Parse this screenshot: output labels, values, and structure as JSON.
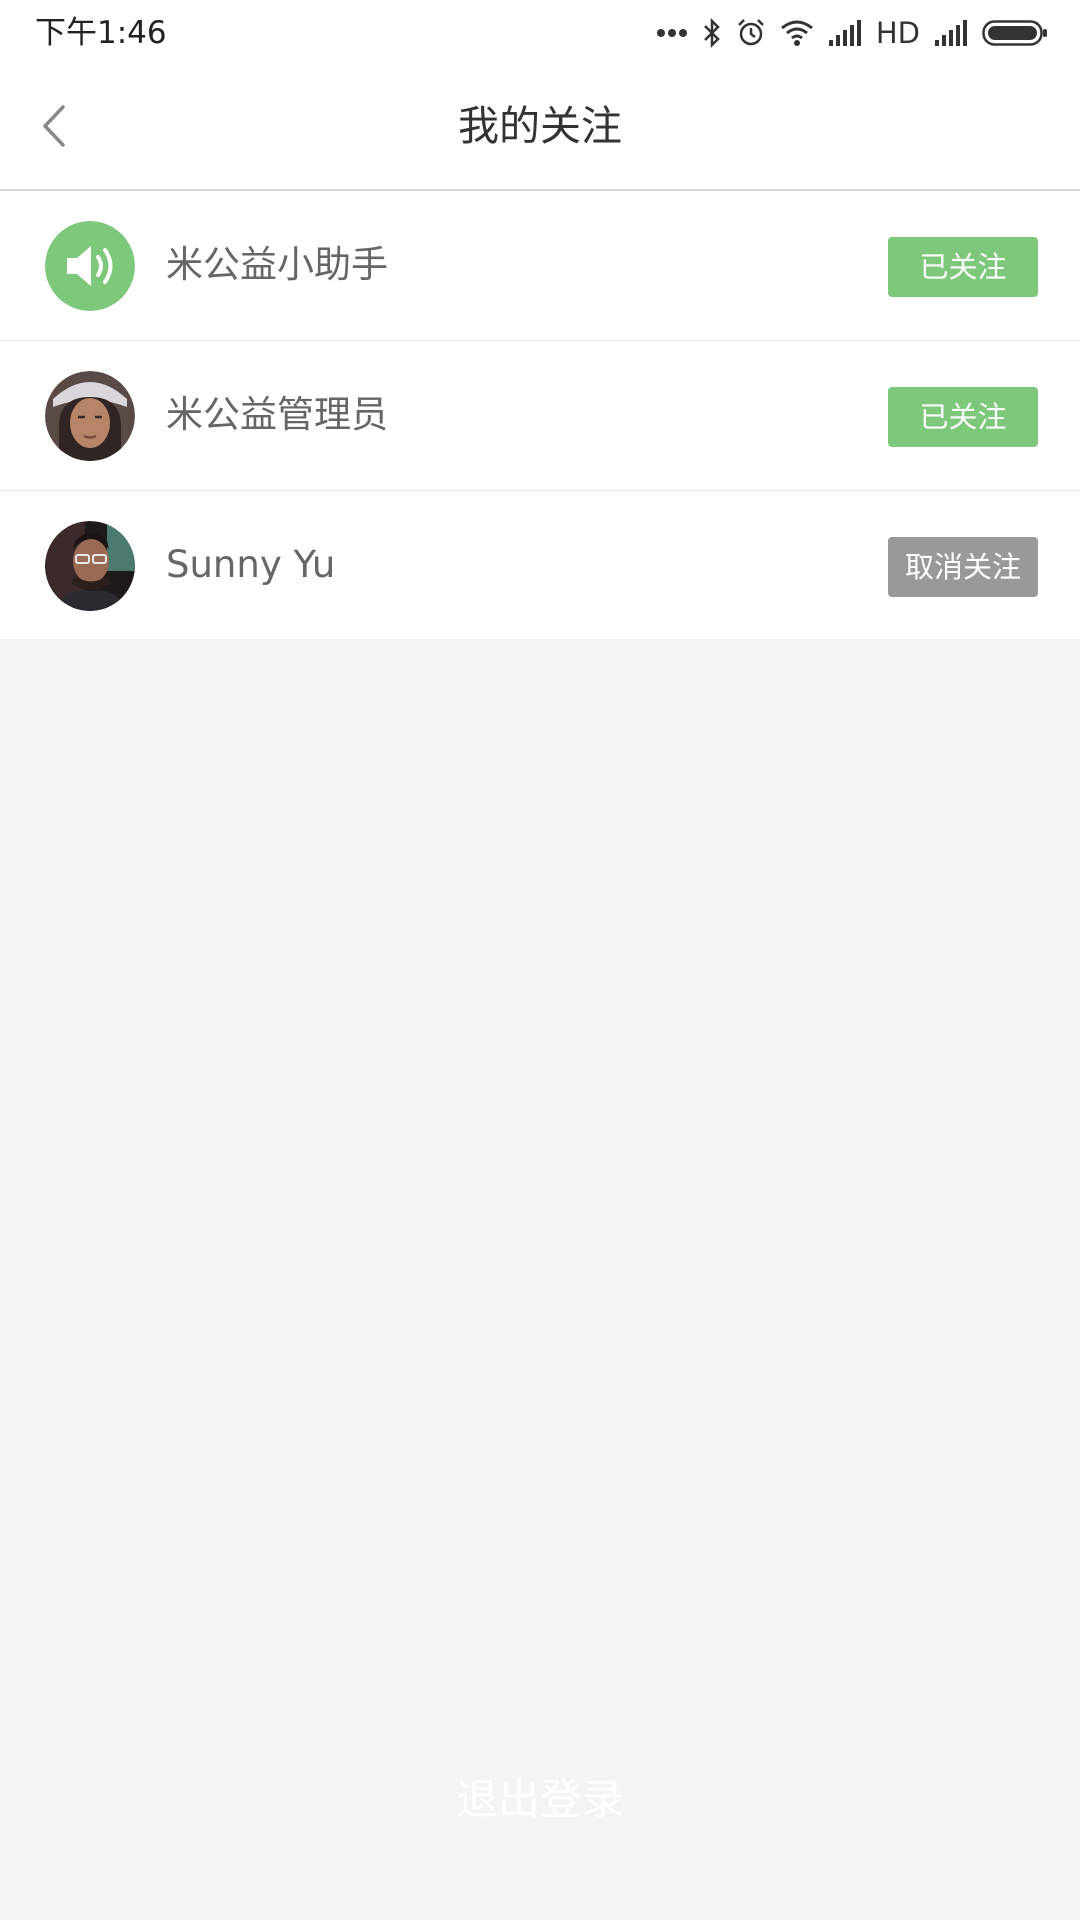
{
  "status_bar": {
    "time": "下午1:46",
    "network_label": "HD",
    "icons": [
      "more-dots-icon",
      "bluetooth-icon",
      "alarm-icon",
      "wifi-icon",
      "signal-icon",
      "signal-icon-2",
      "battery-icon"
    ]
  },
  "header": {
    "title": "我的关注",
    "back_icon": "chevron-left-icon"
  },
  "follows": [
    {
      "name": "米公益小助手",
      "avatar": "speaker-icon",
      "button_label": "已关注",
      "button_color": "#7ec87c"
    },
    {
      "name": "米公益管理员",
      "avatar": "woman-portrait",
      "button_label": "已关注",
      "button_color": "#7ec87c"
    },
    {
      "name": "Sunny Yu",
      "avatar": "man-portrait",
      "button_label": "取消关注",
      "button_color": "#999999"
    }
  ],
  "footer": {
    "logout_label": "退出登录"
  },
  "colors": {
    "accent_green": "#7ec87c",
    "unfollow_gray": "#999999",
    "background": "#f4f4f4"
  }
}
